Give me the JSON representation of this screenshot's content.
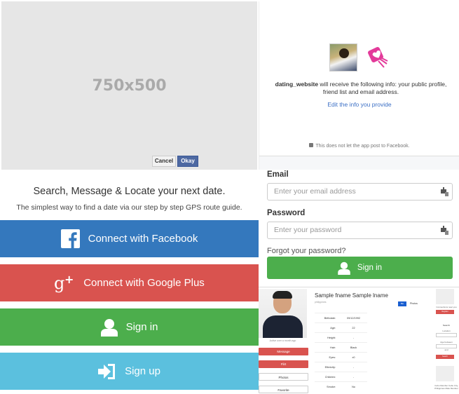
{
  "placeholder": {
    "label": "750x500"
  },
  "fb_dialog": {
    "app_name": "dating_website",
    "info_text": " will receive the following info: your public profile, friend list and email address.",
    "edit_link": "Edit the info you provide",
    "note": "This does not let the app post to Facebook.",
    "cancel_label": "Cancel",
    "okay_label": "Okay"
  },
  "hero": {
    "tagline": "Search, Message & Locate your next date.",
    "subline": "The simplest way to find a date via our step by step GPS route guide."
  },
  "buttons": {
    "facebook": "Connect with Facebook",
    "google": "Connect with Google Plus",
    "signin": "Sign in",
    "signup": "Sign up"
  },
  "colors": {
    "facebook": "#3478bd",
    "google": "#d9534f",
    "signin": "#4cae4c",
    "signup": "#5bc0de"
  },
  "login": {
    "email_label": "Email",
    "email_placeholder": "Enter your email address",
    "password_label": "Password",
    "password_placeholder": "Enter your password",
    "forgot": "Forgot your password?",
    "signin": "Sign in"
  },
  "profile": {
    "name": "Sample fname Sample lname",
    "subtitle": "philippines",
    "photo_caption": "Active over a month ago",
    "tab_active": "Bio",
    "tab_other": "Photos",
    "actions": [
      "Message",
      "Flirt",
      "Photos",
      "Favorite"
    ],
    "rows": [
      {
        "k": "Birthdate:",
        "v": "09/12/1992"
      },
      {
        "k": "Age:",
        "v": "22"
      },
      {
        "k": "Height:",
        "v": "-"
      },
      {
        "k": "Hair:",
        "v": "Black"
      },
      {
        "k": "Eyes:",
        "v": "x0"
      },
      {
        "k": "Ethnicity:",
        "v": "-"
      },
      {
        "k": "Children:",
        "v": "-"
      },
      {
        "k": "Smoke:",
        "v": "No"
      }
    ],
    "right": {
      "text1": "Connections near you",
      "btn1": "Register",
      "search_title": "Search",
      "location": "Location",
      "age_between": "Age between",
      "and": "and",
      "btn2": "Search",
      "footer": "Cebu Member Cebu City, Philippines Male Member"
    }
  }
}
